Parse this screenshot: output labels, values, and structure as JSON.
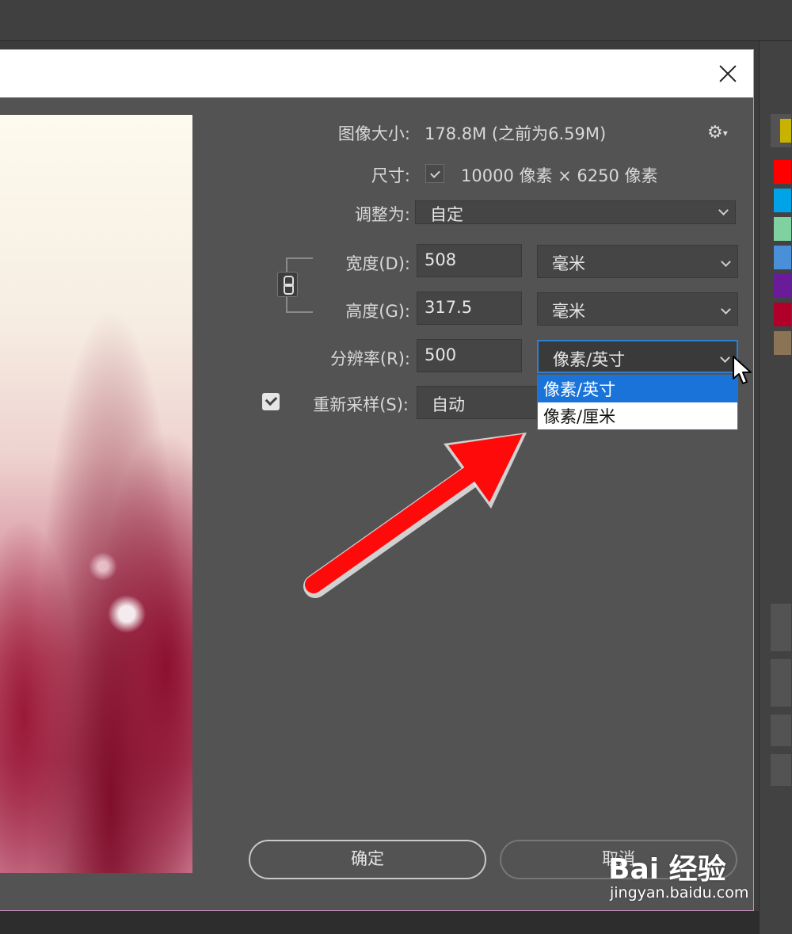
{
  "dialog": {
    "image_size_label": "图像大小:",
    "image_size_value": "178.8M (之前为6.59M)",
    "dimensions_label": "尺寸:",
    "dimensions_value": "10000 像素 × 6250 像素",
    "fit_to_label": "调整为:",
    "fit_to_value": "自定",
    "width_label": "宽度(D):",
    "width_value": "508",
    "width_unit": "毫米",
    "height_label": "高度(G):",
    "height_value": "317.5",
    "height_unit": "毫米",
    "resolution_label": "分辨率(R):",
    "resolution_value": "500",
    "resolution_unit": "像素/英寸",
    "resample_label": "重新采样(S):",
    "resample_value": "自动",
    "resample_checked": true,
    "resolution_unit_options": [
      "像素/英寸",
      "像素/厘米"
    ],
    "ok_label": "确定",
    "cancel_label": "取消"
  },
  "swatches": [
    "#ff0000",
    "#00a2e8",
    "#7fd1a0",
    "#4a90d9",
    "#6a1b9a",
    "#b0002a",
    "#8b7355"
  ],
  "watermark": {
    "main": "Bai 经验",
    "sub": "jingyan.baidu.com"
  },
  "colors": {
    "dialog_bg": "#535353",
    "selection": "#1a73d9",
    "arrow": "#ff0000"
  }
}
